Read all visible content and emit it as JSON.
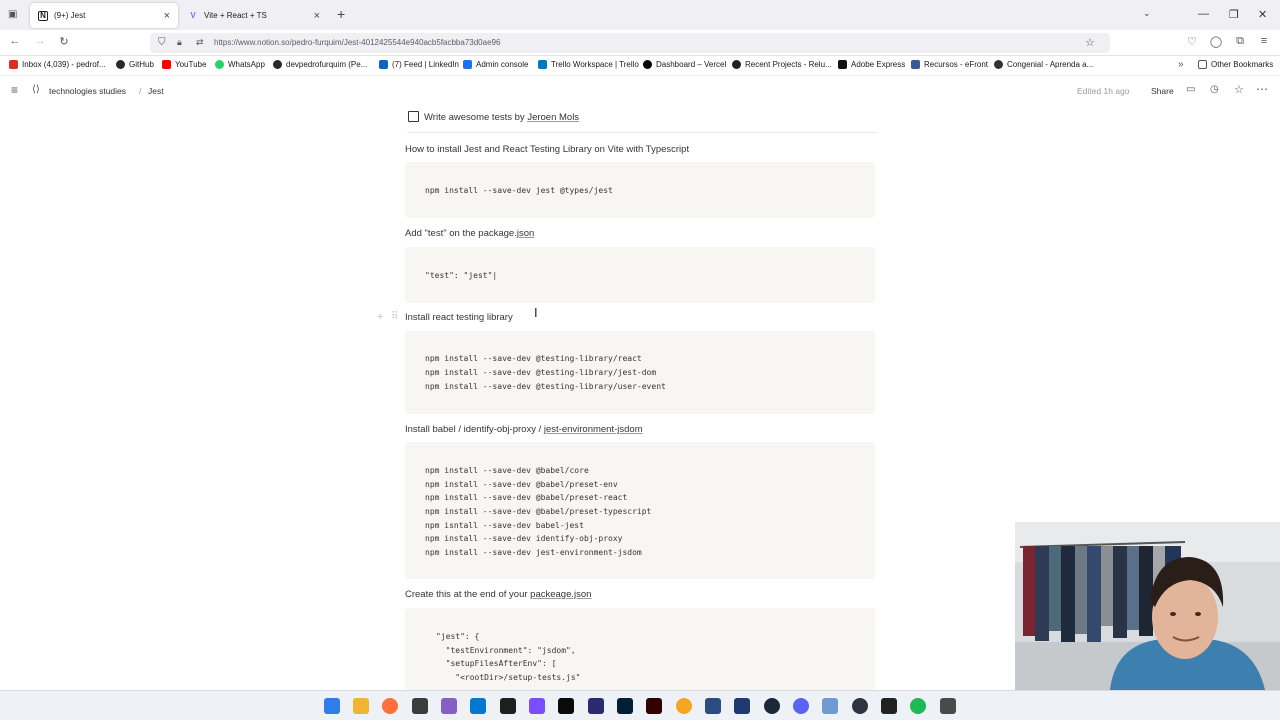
{
  "browser": {
    "tabs": [
      {
        "title": "(9+) Jest",
        "active": true
      },
      {
        "title": "Vite + React + TS",
        "active": false
      }
    ],
    "url": "https://www.notion.so/pedro-furquim/Jest-4012425544e940acb5facbba73d0ae96",
    "bookmarks": [
      {
        "label": "Inbox (4,039) - pedrof...",
        "color": "#d93025"
      },
      {
        "label": "GitHub",
        "color": "#24292f"
      },
      {
        "label": "YouTube",
        "color": "#ff0000"
      },
      {
        "label": "WhatsApp",
        "color": "#25d366"
      },
      {
        "label": "devpedrofurquim (Pe...",
        "color": "#24292f"
      },
      {
        "label": "(7) Feed | LinkedIn",
        "color": "#0a66c2"
      },
      {
        "label": "Admin console",
        "color": "#1a73e8"
      },
      {
        "label": "Trello Workspace | Trello",
        "color": "#0079bf"
      },
      {
        "label": "Dashboard – Vercel",
        "color": "#000000"
      },
      {
        "label": "Recent Projects - Relu...",
        "color": "#222222"
      },
      {
        "label": "Adobe Express",
        "color": "#111111"
      },
      {
        "label": "Recursos - eFront",
        "color": "#3b5998"
      },
      {
        "label": "Congenial - Aprenda a...",
        "color": "#333333"
      }
    ],
    "other_bookmarks": "Other Bookmarks"
  },
  "notion": {
    "breadcrumb": [
      "technologies studies",
      "/",
      "Jest"
    ],
    "edited": "Edited 1h ago",
    "share": "Share"
  },
  "content": {
    "todo": {
      "prefix": "Write awesome tests by ",
      "link": "Jeroen Mols",
      "checked": false
    },
    "sections": [
      {
        "heading": "How to install Jest and React Testing Library on Vite with Typescript",
        "heading_link": "",
        "code": [
          "npm install --save-dev jest @types/jest"
        ]
      },
      {
        "heading": "Add \"test\" on the package.",
        "heading_link": "json",
        "code": [
          "\"test\": \"jest\"|"
        ]
      },
      {
        "heading": "Install react testing library",
        "heading_link": "",
        "code": [
          "npm install --save-dev @testing-library/react",
          "npm install --save-dev @testing-library/jest-dom",
          "npm install --save-dev @testing-library/user-event"
        ]
      },
      {
        "heading": "Install babel / identify-obj-proxy / ",
        "heading_link": "jest-environment-jsdom",
        "code": [
          "npm install --save-dev @babel/core",
          "npm install --save-dev @babel/preset-env",
          "npm install --save-dev @babel/preset-react",
          "npm install --save-dev @babel/preset-typescript",
          "npm isntall --save-dev babel-jest",
          "npm install --save-dev identify-obj-proxy",
          "npm install --save-dev jest-environment-jsdom"
        ]
      },
      {
        "heading": "Create this at the end of your ",
        "heading_link": "packeage.json",
        "code": [
          "\"jest\": {",
          "  \"testEnvironment\": \"jsdom\",",
          "  \"setupFilesAfterEnv\": [",
          "    \"<rootDir>/setup-tests.js\""
        ]
      }
    ]
  },
  "colors": {
    "accent": "#2383e2",
    "code_bg": "#f7f6f3",
    "text": "#37352f"
  }
}
